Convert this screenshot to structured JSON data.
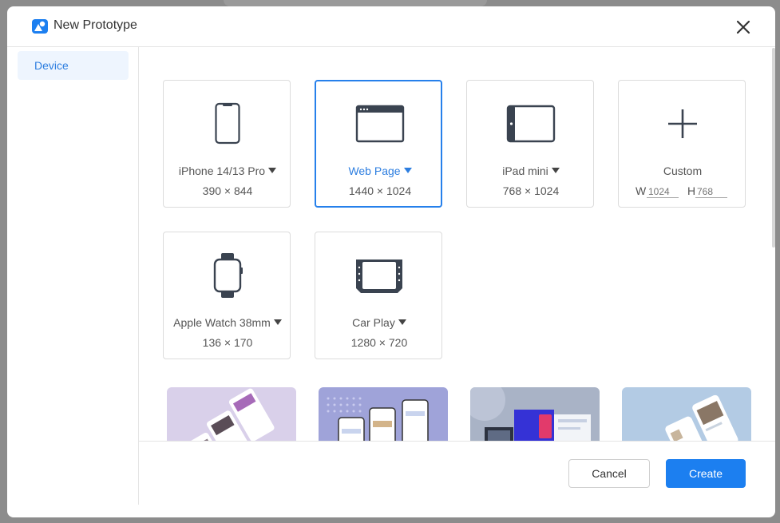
{
  "dialog": {
    "title": "New Prototype"
  },
  "sidebar": {
    "items": [
      {
        "label": "Device",
        "selected": true
      }
    ]
  },
  "devices": [
    {
      "name": "iPhone 14/13 Pro",
      "dims": "390 × 844",
      "icon": "phone-icon",
      "has_dropdown": true,
      "selected": false
    },
    {
      "name": "Web Page",
      "dims": "1440 × 1024",
      "icon": "browser-window-icon",
      "has_dropdown": true,
      "selected": true
    },
    {
      "name": "iPad mini",
      "dims": "768 × 1024",
      "icon": "tablet-icon",
      "has_dropdown": true,
      "selected": false
    },
    {
      "name": "Custom",
      "icon": "plus-icon",
      "has_dropdown": false,
      "selected": false
    },
    {
      "name": "Apple Watch 38mm",
      "dims": "136 × 170",
      "icon": "watch-icon",
      "has_dropdown": true,
      "selected": false
    },
    {
      "name": "Car Play",
      "dims": "1280 × 720",
      "icon": "carplay-screen-icon",
      "has_dropdown": true,
      "selected": false
    }
  ],
  "custom": {
    "width_label": "W",
    "height_label": "H",
    "width_placeholder": "1024",
    "height_placeholder": "768"
  },
  "templates": [
    {
      "name": "template-mobile-app-thumbnail",
      "bg": "#d9d0ea"
    },
    {
      "name": "template-social-feed-thumbnail",
      "bg": "#9fa3d9"
    },
    {
      "name": "template-web-landing-thumbnail",
      "bg": "#a9b3c6"
    },
    {
      "name": "template-blog-app-thumbnail",
      "bg": "#b3cbe4"
    }
  ],
  "footer": {
    "cancel_label": "Cancel",
    "create_label": "Create"
  },
  "colors": {
    "accent": "#1c7ff0",
    "selected_text": "#2d7ee0",
    "sidebar_selected_bg": "#eef5fe"
  }
}
